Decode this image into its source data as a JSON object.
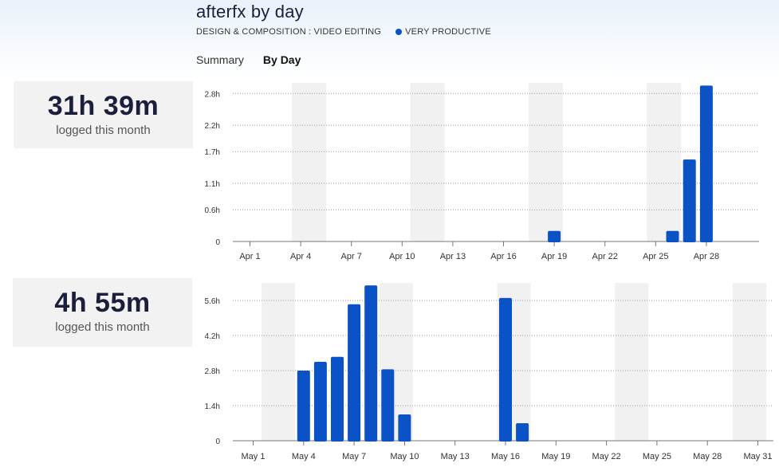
{
  "header": {
    "title": "afterfx by day",
    "category": "DESIGN & COMPOSITION : VIDEO EDITING",
    "productivity": "VERY PRODUCTIVE",
    "productivity_color": "#0b52c7"
  },
  "tabs": [
    {
      "label": "Summary",
      "active": false
    },
    {
      "label": "By Day",
      "active": true
    }
  ],
  "months": [
    {
      "total": "31h 39m",
      "label": "logged this month"
    },
    {
      "total": "4h 55m",
      "label": "logged this month"
    }
  ],
  "colors": {
    "bar": "#0b52c7",
    "weekend": "#f1f1f1",
    "grid": "#999999"
  },
  "chart_data": [
    {
      "type": "bar",
      "month": "April",
      "days": 30,
      "yticks": [
        0,
        0.6,
        1.1,
        1.7,
        2.2,
        2.8
      ],
      "ytick_labels": [
        "0",
        "0.6h",
        "1.1h",
        "1.7h",
        "2.2h",
        "2.8h"
      ],
      "ylim": [
        0,
        3.0
      ],
      "xtick_days": [
        1,
        4,
        7,
        10,
        13,
        16,
        19,
        22,
        25,
        28
      ],
      "xtick_labels": [
        "Apr 1",
        "Apr 4",
        "Apr 7",
        "Apr 10",
        "Apr 13",
        "Apr 16",
        "Apr 19",
        "Apr 22",
        "Apr 25",
        "Apr 28"
      ],
      "weekend_pairs": [
        [
          4,
          5
        ],
        [
          11,
          12
        ],
        [
          18,
          19
        ],
        [
          25,
          26
        ]
      ],
      "values": [
        {
          "day": 19,
          "hours": 0.2
        },
        {
          "day": 26,
          "hours": 0.2
        },
        {
          "day": 27,
          "hours": 1.55
        },
        {
          "day": 28,
          "hours": 2.95
        }
      ]
    },
    {
      "type": "bar",
      "month": "May",
      "days": 31,
      "yticks": [
        0,
        1.4,
        2.8,
        4.2,
        5.6
      ],
      "ytick_labels": [
        "0",
        "1.4h",
        "2.8h",
        "4.2h",
        "5.6h"
      ],
      "ylim": [
        0,
        6.3
      ],
      "xtick_days": [
        1,
        4,
        7,
        10,
        13,
        16,
        19,
        22,
        25,
        28,
        31
      ],
      "xtick_labels": [
        "May 1",
        "May 4",
        "May 7",
        "May 10",
        "May 13",
        "May 16",
        "May 19",
        "May 22",
        "May 25",
        "May 28",
        "May 31"
      ],
      "weekend_pairs": [
        [
          2,
          3
        ],
        [
          9,
          10
        ],
        [
          16,
          17
        ],
        [
          23,
          24
        ],
        [
          30,
          31
        ]
      ],
      "values": [
        {
          "day": 4,
          "hours": 2.8
        },
        {
          "day": 5,
          "hours": 3.15
        },
        {
          "day": 6,
          "hours": 3.35
        },
        {
          "day": 7,
          "hours": 5.45
        },
        {
          "day": 8,
          "hours": 6.2
        },
        {
          "day": 9,
          "hours": 2.85
        },
        {
          "day": 10,
          "hours": 1.05
        },
        {
          "day": 16,
          "hours": 5.7
        },
        {
          "day": 17,
          "hours": 0.7
        }
      ]
    }
  ]
}
